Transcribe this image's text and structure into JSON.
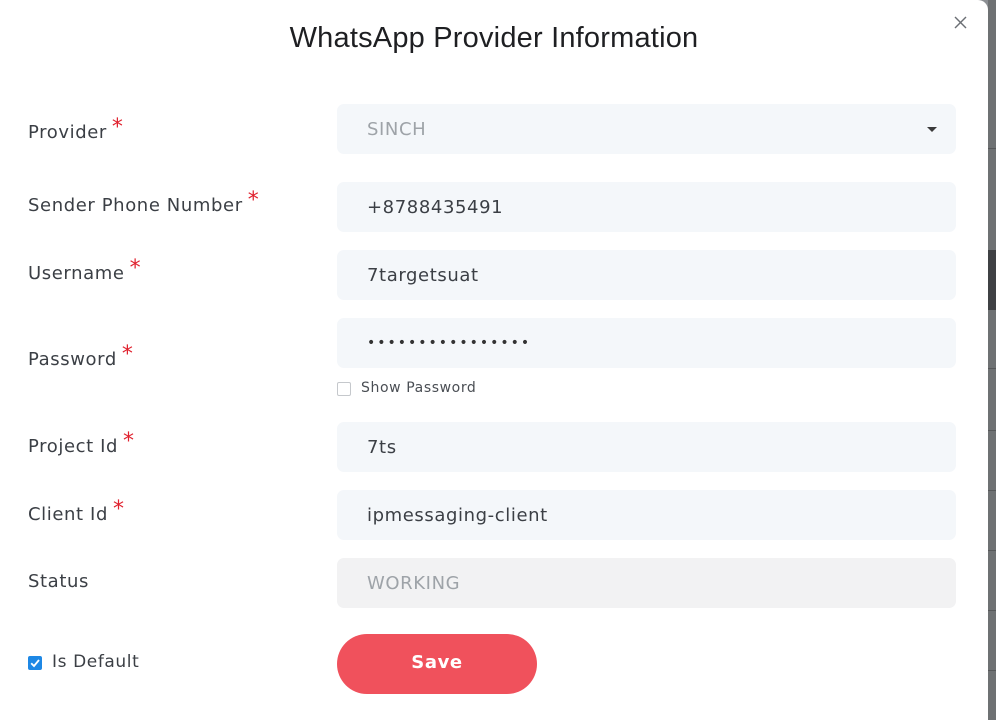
{
  "modal": {
    "title": "WhatsApp Provider Information",
    "close_label": "×"
  },
  "form": {
    "provider": {
      "label": "Provider",
      "value": "SINCH",
      "required": "*"
    },
    "sender_phone": {
      "label": "Sender Phone Number",
      "value": "+8788435491",
      "required": "*"
    },
    "username": {
      "label": "Username",
      "value": "7targetsuat",
      "required": "*"
    },
    "password": {
      "label": "Password",
      "value": "••••••••••••••••",
      "required": "*",
      "show_password_label": "Show Password",
      "show_password_checked": false
    },
    "project_id": {
      "label": "Project Id",
      "value": "7ts",
      "required": "*"
    },
    "client_id": {
      "label": "Client Id",
      "value": "ipmessaging-client",
      "required": "*"
    },
    "status": {
      "label": "Status",
      "value": "WORKING"
    },
    "is_default": {
      "label": "Is Default",
      "checked": true
    },
    "save_label": "Save"
  },
  "colors": {
    "accent": "#f0515c",
    "required": "#e0222f",
    "checkbox_checked": "#1e88e5",
    "field_bg": "#f4f7fa"
  },
  "icons": {
    "close": "close-icon",
    "dropdown": "chevron-down-icon",
    "check": "check-icon"
  }
}
